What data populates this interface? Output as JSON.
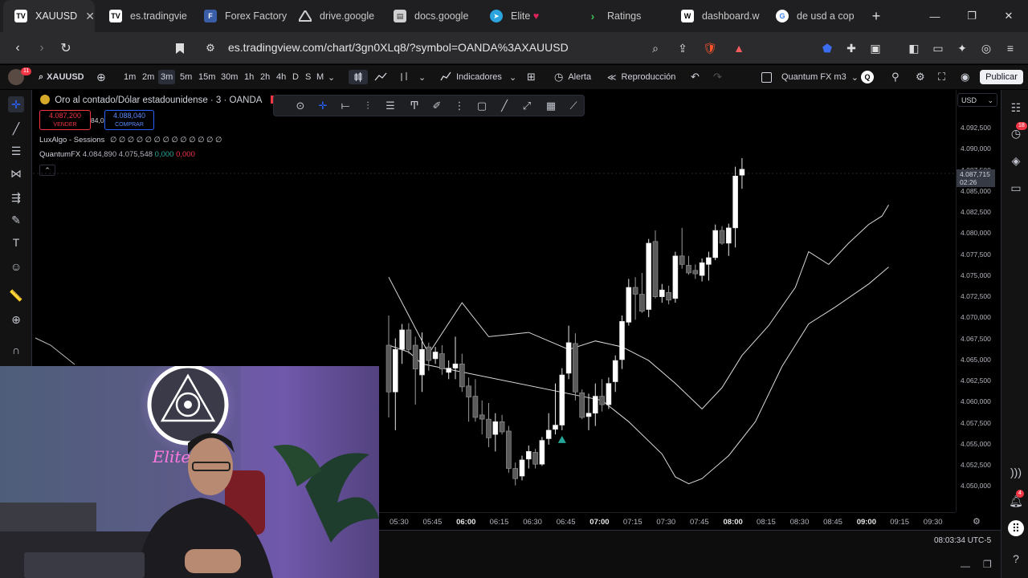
{
  "browser": {
    "tabs": [
      {
        "title": "XAUUSD",
        "icon": "tradingview-icon",
        "active": true
      },
      {
        "title": "es.tradingvie",
        "icon": "tradingview-icon",
        "active": false
      },
      {
        "title": "Forex Factory",
        "icon": "forex-factory-icon",
        "active": false
      },
      {
        "title": "drive.google",
        "icon": "google-drive-icon",
        "active": false
      },
      {
        "title": "docs.google",
        "icon": "google-docs-icon",
        "active": false
      },
      {
        "title": "Elite",
        "icon": "telegram-icon",
        "active": false
      },
      {
        "title": "Ratings",
        "icon": "ratings-icon",
        "active": false
      },
      {
        "title": "dashboard.w",
        "icon": "dashboard-icon",
        "active": false
      },
      {
        "title": "de usd a cop",
        "icon": "google-icon",
        "active": false
      }
    ],
    "url": "es.tradingview.com/chart/3gn0XLq8/?symbol=OANDA%3AXAUUSD",
    "brave_badge": "2",
    "alert_badge": "1"
  },
  "tv": {
    "avatar_badge": "11",
    "symbol": "XAUUSD",
    "timeframes": [
      "1m",
      "2m",
      "3m",
      "5m",
      "15m",
      "30m",
      "1h",
      "2h",
      "4h",
      "D",
      "S",
      "M"
    ],
    "active_timeframe": "3m",
    "indicators_label": "Indicadores",
    "alert_label": "Alerta",
    "replay_label": "Reproducción",
    "layout_name": "Quantum FX m3",
    "layout_badge": "Q",
    "publish_label": "Publicar",
    "currency": "USD",
    "right_badges": {
      "watchlist": "18",
      "notifications": "4"
    },
    "colors": {
      "sell": "#f23645",
      "buy": "#2962ff",
      "signal": "#26a69a",
      "band": "#d9d9d9"
    }
  },
  "legend": {
    "title": "Oro al contado/Dólar estadounidense · 3 · OANDA",
    "sell_price": "4.087,200",
    "sell_label": "VENDER",
    "spread": "84,0",
    "buy_price": "4.088,040",
    "buy_label": "COMPRAR",
    "ind1_name": "LuxAlgo - Sessions",
    "ind1_values": "∅ ∅ ∅ ∅ ∅ ∅ ∅ ∅ ∅ ∅ ∅ ∅ ∅",
    "ind2_name": "QuantumFX",
    "ind2_v1": "4.084,890",
    "ind2_v2": "4.075,548",
    "ind2_v3": "0,000",
    "ind2_v4": "0,000",
    "collapse_icon": "chevron-up-icon"
  },
  "axis": {
    "y_ticks": [
      "4.092,500",
      "4.090,000",
      "4.087,500",
      "4.085,000",
      "4.082,500",
      "4.080,000",
      "4.077,500",
      "4.075,000",
      "4.072,500",
      "4.070,000",
      "4.067,500",
      "4.065,000",
      "4.062,500",
      "4.060,000",
      "4.057,500",
      "4.055,000",
      "4.052,500",
      "4.050,000"
    ],
    "current_price": "4.087,715",
    "countdown": "02:26",
    "x_ticks": [
      "05:30",
      "05:45",
      "06:00",
      "06:15",
      "06:30",
      "06:45",
      "07:00",
      "07:15",
      "07:30",
      "07:45",
      "08:00",
      "08:15",
      "08:30",
      "08:45",
      "09:00",
      "09:15",
      "09:30"
    ],
    "clock": "08:03:34 UTC-5"
  },
  "webcam": {
    "sign_text": "Elite"
  },
  "chart_data": {
    "type": "candlestick",
    "symbol": "XAUUSD",
    "timeframe": "3m",
    "ylim": [
      4048500,
      4094500
    ],
    "candles": [
      [
        4067000,
        4070500,
        4058500,
        4061500
      ],
      [
        4061500,
        4067800,
        4057000,
        4066500
      ],
      [
        4066500,
        4069500,
        4064800,
        4068800
      ],
      [
        4068800,
        4069600,
        4066000,
        4066500
      ],
      [
        4067000,
        4068000,
        4060000,
        4064200
      ],
      [
        4063500,
        4068500,
        4061500,
        4066500
      ],
      [
        4066800,
        4067300,
        4064000,
        4065200
      ],
      [
        4065400,
        4066800,
        4064800,
        4066200
      ],
      [
        4066000,
        4067000,
        4063500,
        4064200
      ],
      [
        4063800,
        4065200,
        4063000,
        4064300
      ],
      [
        4064300,
        4068000,
        4063000,
        4064800
      ],
      [
        4064800,
        4066000,
        4061500,
        4062100
      ],
      [
        4062200,
        4063200,
        4058000,
        4060900
      ],
      [
        4061000,
        4063000,
        4058000,
        4058500
      ],
      [
        4058800,
        4060500,
        4056500,
        4058300
      ],
      [
        4058300,
        4060200,
        4055000,
        4056100
      ],
      [
        4056500,
        4059000,
        4054500,
        4058000
      ],
      [
        4058000,
        4058800,
        4056500,
        4056800
      ],
      [
        4056900,
        4057500,
        4052000,
        4052500
      ],
      [
        4052500,
        4053200,
        4050500,
        4051300
      ],
      [
        4051600,
        4054000,
        4051100,
        4053500
      ],
      [
        4053600,
        4055200,
        4052500,
        4054500
      ],
      [
        4054400,
        4054800,
        4052500,
        4053000
      ],
      [
        4053000,
        4056200,
        4052800,
        4055800
      ],
      [
        4056000,
        4059000,
        4055300,
        4057000
      ],
      [
        4057100,
        4062500,
        4056500,
        4057600
      ],
      [
        4057600,
        4064300,
        4057000,
        4063500
      ],
      [
        4063700,
        4069300,
        4063000,
        4067300
      ],
      [
        4067200,
        4068400,
        4060500,
        4061500
      ],
      [
        4061400,
        4061800,
        4058300,
        4058500
      ],
      [
        4058600,
        4061300,
        4057000,
        4059000
      ],
      [
        4059000,
        4062500,
        4057500,
        4061000
      ],
      [
        4061000,
        4063000,
        4059200,
        4060000
      ],
      [
        4060000,
        4063200,
        4059500,
        4062500
      ],
      [
        4062700,
        4065800,
        4061500,
        4065200
      ],
      [
        4065300,
        4070500,
        4064200,
        4069800
      ],
      [
        4069700,
        4074800,
        4069300,
        4073800
      ],
      [
        4073800,
        4075000,
        4070000,
        4073000
      ],
      [
        4073000,
        4075500,
        4070800,
        4071000
      ],
      [
        4071200,
        4079500,
        4070300,
        4079000
      ],
      [
        4079200,
        4080500,
        4072500,
        4072700
      ],
      [
        4072700,
        4074200,
        4072000,
        4073500
      ],
      [
        4073200,
        4074000,
        4071800,
        4072300
      ],
      [
        4072500,
        4078000,
        4072000,
        4077500
      ],
      [
        4077500,
        4080800,
        4076000,
        4076500
      ],
      [
        4076400,
        4077500,
        4075300,
        4075500
      ],
      [
        4075800,
        4076500,
        4074800,
        4075400
      ],
      [
        4075200,
        4077200,
        4074500,
        4076700
      ],
      [
        4076500,
        4078000,
        4074600,
        4077300
      ],
      [
        4077300,
        4081200,
        4077000,
        4080500
      ],
      [
        4080500,
        4081000,
        4078800,
        4079000
      ],
      [
        4079000,
        4081300,
        4077500,
        4080800
      ],
      [
        4080800,
        4088000,
        4078500,
        4086900
      ],
      [
        4087000,
        4089000,
        4085400,
        4087700
      ]
    ],
    "upper_band": [
      [
        1,
        4075000
      ],
      [
        7,
        4066000
      ],
      [
        12,
        4072000
      ],
      [
        16,
        4068000
      ],
      [
        22,
        4068500
      ],
      [
        28,
        4066500
      ],
      [
        32,
        4067500
      ],
      [
        36,
        4066800
      ],
      [
        40,
        4065200
      ],
      [
        44,
        4062500
      ],
      [
        48,
        4059500
      ],
      [
        51,
        4062000
      ],
      [
        54,
        4065800
      ],
      [
        58,
        4069300
      ],
      [
        62,
        4073800
      ],
      [
        64,
        4078000
      ],
      [
        67,
        4076500
      ],
      [
        70,
        4079000
      ],
      [
        73,
        4081200
      ],
      [
        75,
        4082200
      ],
      [
        76,
        4083500
      ]
    ],
    "lower_band": [
      [
        1,
        4067000
      ],
      [
        4,
        4066200
      ],
      [
        6,
        4064800
      ],
      [
        33,
        4060500
      ],
      [
        37,
        4058000
      ],
      [
        42,
        4054200
      ],
      [
        44,
        4051500
      ],
      [
        46,
        4050700
      ],
      [
        48,
        4051300
      ],
      [
        52,
        4054000
      ],
      [
        56,
        4058000
      ],
      [
        60,
        4064500
      ],
      [
        64,
        4069500
      ],
      [
        68,
        4071500
      ],
      [
        73,
        4074200
      ],
      [
        76,
        4076200
      ]
    ],
    "signals": [
      {
        "index": 26,
        "type": "buy"
      }
    ]
  }
}
